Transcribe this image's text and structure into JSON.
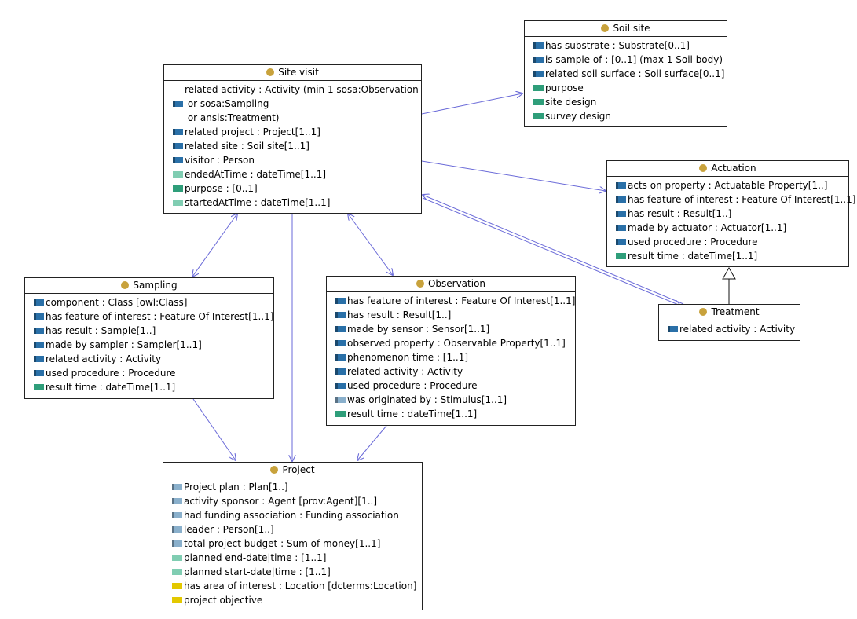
{
  "colors": {
    "class_dot": "#c8a23c",
    "edge": "#6a6ad8",
    "border": "#222222",
    "object_property": "#2a70a8",
    "data_property": "#2f9e7a",
    "light_object_property": "#8ab0cc",
    "light_data_property": "#80cdb2",
    "annotation_property": "#e3c800"
  },
  "classes": {
    "soil_site": {
      "title": "Soil site",
      "attrs": [
        {
          "text": "has substrate : Substrate[0..1]",
          "kind": "object"
        },
        {
          "text": "is sample of : [0..1] (max 1 Soil body)",
          "kind": "object"
        },
        {
          "text": "related soil surface : Soil surface[0..1]",
          "kind": "object"
        },
        {
          "text": "purpose",
          "kind": "data"
        },
        {
          "text": "site design",
          "kind": "data"
        },
        {
          "text": "survey design",
          "kind": "data"
        }
      ]
    },
    "site_visit": {
      "title": "Site visit",
      "attrs": [
        {
          "lines": [
            "related activity : Activity (min 1 sosa:Observation",
            " or sosa:Sampling",
            " or ansis:Treatment)"
          ],
          "kind": "object"
        },
        {
          "text": "related project : Project[1..1]",
          "kind": "object"
        },
        {
          "text": "related site : Soil site[1..1]",
          "kind": "object"
        },
        {
          "text": "visitor : Person",
          "kind": "object"
        },
        {
          "text": "endedAtTime : dateTime[1..1]",
          "kind": "light_data"
        },
        {
          "text": "purpose : [0..1]",
          "kind": "data"
        },
        {
          "text": "startedAtTime : dateTime[1..1]",
          "kind": "light_data"
        }
      ]
    },
    "actuation": {
      "title": "Actuation",
      "attrs": [
        {
          "text": "acts on property : Actuatable Property[1..]",
          "kind": "object"
        },
        {
          "text": "has feature of interest : Feature Of Interest[1..1]",
          "kind": "object"
        },
        {
          "text": "has result : Result[1..]",
          "kind": "object"
        },
        {
          "text": "made by actuator : Actuator[1..1]",
          "kind": "object"
        },
        {
          "text": "used procedure : Procedure",
          "kind": "object"
        },
        {
          "text": "result time : dateTime[1..1]",
          "kind": "data"
        }
      ]
    },
    "treatment": {
      "title": "Treatment",
      "attrs": [
        {
          "text": "related activity : Activity",
          "kind": "object"
        }
      ]
    },
    "sampling": {
      "title": "Sampling",
      "attrs": [
        {
          "text": "component : Class  [owl:Class]",
          "kind": "object"
        },
        {
          "text": "has feature of interest : Feature Of Interest[1..1]",
          "kind": "object"
        },
        {
          "text": "has result : Sample[1..]",
          "kind": "object"
        },
        {
          "text": "made by sampler : Sampler[1..1]",
          "kind": "object"
        },
        {
          "text": "related activity : Activity",
          "kind": "object"
        },
        {
          "text": "used procedure : Procedure",
          "kind": "object"
        },
        {
          "text": "result time : dateTime[1..1]",
          "kind": "data"
        }
      ]
    },
    "observation": {
      "title": "Observation",
      "attrs": [
        {
          "text": "has feature of interest : Feature Of Interest[1..1]",
          "kind": "object"
        },
        {
          "text": "has result : Result[1..]",
          "kind": "object"
        },
        {
          "text": "made by sensor : Sensor[1..1]",
          "kind": "object"
        },
        {
          "text": "observed property : Observable Property[1..1]",
          "kind": "object"
        },
        {
          "text": "phenomenon time : [1..1]",
          "kind": "object"
        },
        {
          "text": "related activity : Activity",
          "kind": "object"
        },
        {
          "text": "used procedure : Procedure",
          "kind": "object"
        },
        {
          "text": "was originated by : Stimulus[1..1]",
          "kind": "light_object"
        },
        {
          "text": "result time : dateTime[1..1]",
          "kind": "data"
        }
      ]
    },
    "project": {
      "title": "Project",
      "attrs": [
        {
          "text": "Project plan : Plan[1..]",
          "kind": "light_object"
        },
        {
          "text": "activity sponsor : Agent  [prov:Agent][1..]",
          "kind": "light_object"
        },
        {
          "text": "had funding association : Funding association",
          "kind": "light_object"
        },
        {
          "text": "leader : Person[1..]",
          "kind": "light_object"
        },
        {
          "text": "total project budget : Sum of money[1..1]",
          "kind": "light_object"
        },
        {
          "text": "planned end-date|time : [1..1]",
          "kind": "light_data"
        },
        {
          "text": "planned start-date|time : [1..1]",
          "kind": "light_data"
        },
        {
          "text": "has area of interest : Location  [dcterms:Location]",
          "kind": "annotation"
        },
        {
          "text": "project objective",
          "kind": "annotation"
        }
      ]
    }
  }
}
